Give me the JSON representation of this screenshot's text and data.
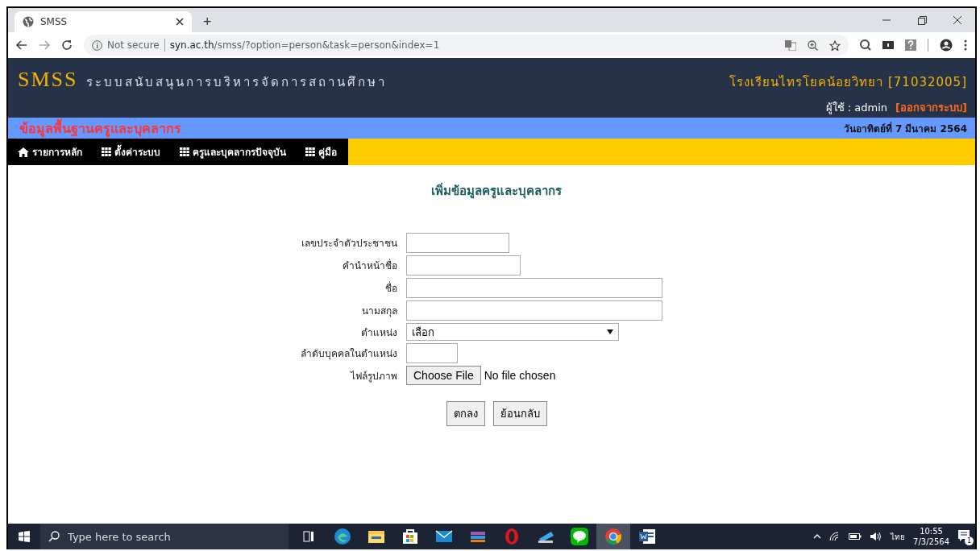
{
  "browser": {
    "tab": {
      "title": "SMSS",
      "selected": true
    },
    "new_tab": "+",
    "security": "Not secure",
    "url_host": "syn.ac.th",
    "url_path": "/smss/?option=person&task=person&index=1"
  },
  "header": {
    "logo": "SMSS",
    "system_name": "ระบบสนับสนุนการบริหารจัดการสถานศึกษา",
    "school": "โรงเรียนไทรโยคน้อยวิทยา [71032005]",
    "user": "ผู้ใช้ : admin",
    "logout": "[ออกจากระบบ]"
  },
  "subheader": {
    "title": "ข้อมูลพื้นฐานครูและบุคลากร",
    "date": "วันอาทิตย์ที่ 7 มีนาคม 2564"
  },
  "menu": [
    {
      "label": "รายการหลัก",
      "kind": "home"
    },
    {
      "label": "ตั้งค่าระบบ",
      "kind": "grid"
    },
    {
      "label": "ครูและบุคลากรปัจจุบัน",
      "kind": "grid"
    },
    {
      "label": "คู่มือ",
      "kind": "grid"
    }
  ],
  "form": {
    "title": "เพิ่มข้อมูลครูและบุคลากร",
    "fields": [
      {
        "label": "เลขประจำตัวประชาชน",
        "kind": "text"
      },
      {
        "label": "คำนำหน้าชื่อ",
        "kind": "text"
      },
      {
        "label": "ชื่อ",
        "kind": "text"
      },
      {
        "label": "นามสกุล",
        "kind": "text"
      },
      {
        "label": "ตำแหน่ง",
        "kind": "select",
        "value": "เลือก"
      },
      {
        "label": "ลำดับบุคคลในตำแหน่ง",
        "kind": "text"
      },
      {
        "label": "ไฟล์รูปภาพ",
        "kind": "file",
        "button": "Choose File",
        "status": "No file chosen"
      }
    ],
    "buttons": [
      "ตกลง",
      "ย้อนกลับ"
    ]
  },
  "taskbar": {
    "search": {
      "placeholder": "Type here to search"
    },
    "apps": [
      {
        "kind": "taskview",
        "selected": false
      },
      {
        "kind": "edge",
        "selected": false
      },
      {
        "kind": "files",
        "selected": false
      },
      {
        "kind": "store",
        "selected": false
      },
      {
        "kind": "mail",
        "selected": false
      },
      {
        "kind": "archive",
        "selected": false
      },
      {
        "kind": "opera",
        "selected": false
      },
      {
        "kind": "remote",
        "selected": false
      },
      {
        "kind": "line",
        "selected": false
      },
      {
        "kind": "chrome",
        "selected": true
      },
      {
        "kind": "word",
        "selected": false
      }
    ],
    "language": "ไทย",
    "time": "10:55",
    "date": "7/3/2564",
    "notifications": "1"
  }
}
